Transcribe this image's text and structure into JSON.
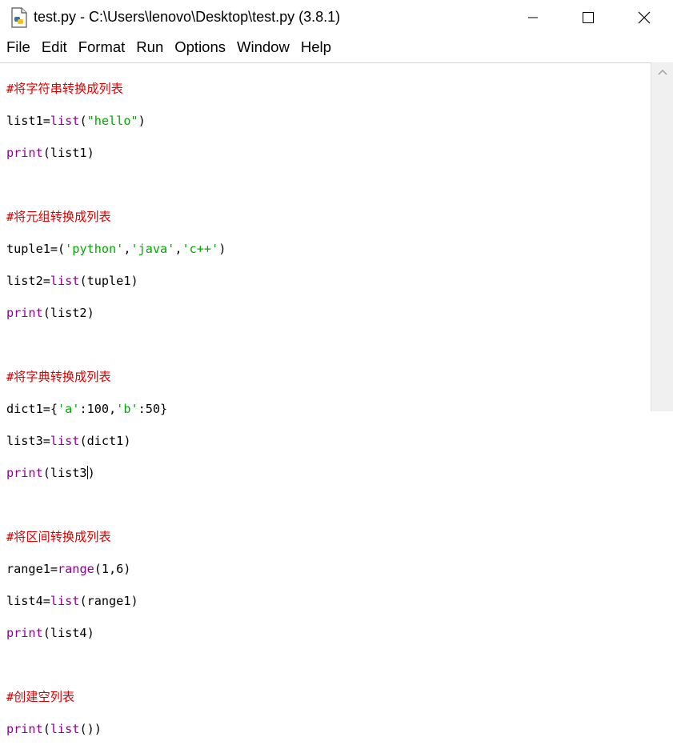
{
  "window": {
    "title": "test.py - C:\\Users\\lenovo\\Desktop\\test.py (3.8.1)",
    "controls": [
      "minimize-icon",
      "maximize-icon",
      "close-icon"
    ]
  },
  "menu": [
    "File",
    "Edit",
    "Format",
    "Run",
    "Options",
    "Window",
    "Help"
  ],
  "code": {
    "comment1": "#将字符串转换成列表",
    "l2_a": "list1=",
    "l2_b": "list",
    "l2_c": "(",
    "l2_d": "\"hello\"",
    "l2_e": ")",
    "l3_a": "print",
    "l3_b": "(list1)",
    "comment2": "#将元组转换成列表",
    "l6_a": "tuple1=(",
    "l6_b": "'python'",
    "l6_c": ",",
    "l6_d": "'java'",
    "l6_e": ",",
    "l6_f": "'c++'",
    "l6_g": ")",
    "l7_a": "list2=",
    "l7_b": "list",
    "l7_c": "(tuple1)",
    "l8_a": "print",
    "l8_b": "(list2)",
    "comment3": "#将字典转换成列表",
    "l11_a": "dict1={",
    "l11_b": "'a'",
    "l11_c": ":100,",
    "l11_d": "'b'",
    "l11_e": ":50}",
    "l12_a": "list3=",
    "l12_b": "list",
    "l12_c": "(dict1)",
    "l13_a": "print",
    "l13_b": "(list3",
    "l13_c": ")",
    "comment4": "#将区间转换成列表",
    "l16_a": "range1=",
    "l16_b": "range",
    "l16_c": "(1,6)",
    "l17_a": "list4=",
    "l17_b": "list",
    "l17_c": "(range1)",
    "l18_a": "print",
    "l18_b": "(list4)",
    "comment5": "#创建空列表",
    "l21_a": "print",
    "l21_b": "(",
    "l21_c": "list",
    "l21_d": "())"
  },
  "colors": {
    "comment": "#dd0000",
    "builtin": "#900090",
    "string": "#00aa00"
  }
}
